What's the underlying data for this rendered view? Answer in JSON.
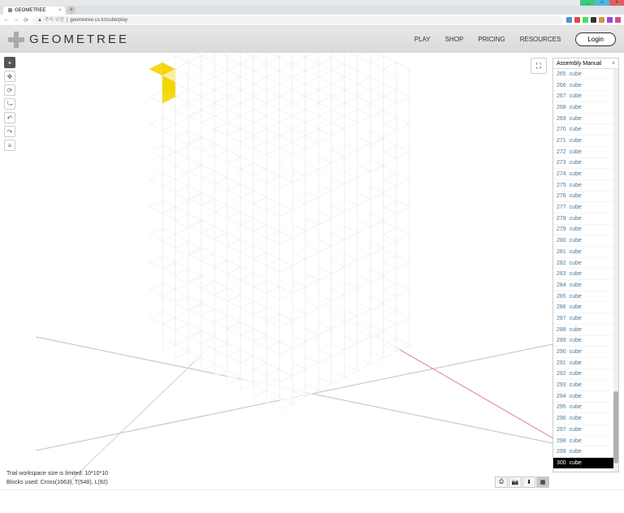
{
  "window": {
    "title": "GEOMETREE"
  },
  "browser": {
    "tab_title": "GEOMETREE",
    "url": "geometree.co.kr/cube/play"
  },
  "header": {
    "brand": "GEOMETREE",
    "nav": {
      "play": "PLAY",
      "shop": "SHOP",
      "pricing": "PRICING",
      "resources": "RESOURCES"
    },
    "login": "Login"
  },
  "toolbar": {
    "add": "+",
    "move": "✥",
    "rotate": "⟳",
    "orbit": "⤿",
    "undo": "↶",
    "redo": "↷",
    "list": "≡"
  },
  "panel": {
    "title": "Assembly Manual",
    "items": [
      {
        "n": "265",
        "t": "cube"
      },
      {
        "n": "266",
        "t": "cube"
      },
      {
        "n": "267",
        "t": "cube"
      },
      {
        "n": "268",
        "t": "cube"
      },
      {
        "n": "269",
        "t": "cube"
      },
      {
        "n": "270",
        "t": "cube"
      },
      {
        "n": "271",
        "t": "cube"
      },
      {
        "n": "272",
        "t": "cube"
      },
      {
        "n": "273",
        "t": "cube"
      },
      {
        "n": "274",
        "t": "cube"
      },
      {
        "n": "275",
        "t": "cube"
      },
      {
        "n": "276",
        "t": "cube"
      },
      {
        "n": "277",
        "t": "cube"
      },
      {
        "n": "278",
        "t": "cube"
      },
      {
        "n": "279",
        "t": "cube"
      },
      {
        "n": "280",
        "t": "cube"
      },
      {
        "n": "281",
        "t": "cube"
      },
      {
        "n": "282",
        "t": "cube"
      },
      {
        "n": "283",
        "t": "cube"
      },
      {
        "n": "284",
        "t": "cube"
      },
      {
        "n": "285",
        "t": "cube"
      },
      {
        "n": "286",
        "t": "cube"
      },
      {
        "n": "287",
        "t": "cube"
      },
      {
        "n": "288",
        "t": "cube"
      },
      {
        "n": "289",
        "t": "cube"
      },
      {
        "n": "290",
        "t": "cube"
      },
      {
        "n": "291",
        "t": "cube"
      },
      {
        "n": "292",
        "t": "cube"
      },
      {
        "n": "293",
        "t": "cube"
      },
      {
        "n": "294",
        "t": "cube"
      },
      {
        "n": "295",
        "t": "cube"
      },
      {
        "n": "296",
        "t": "cube"
      },
      {
        "n": "297",
        "t": "cube"
      },
      {
        "n": "298",
        "t": "cube"
      },
      {
        "n": "299",
        "t": "cube"
      },
      {
        "n": "300",
        "t": "cube"
      }
    ],
    "selected_index": 35,
    "scroll": {
      "thumb_top_pct": 80,
      "thumb_height_pct": 18
    }
  },
  "status": {
    "line1": "Trial workspace size is limited: 10*10*10",
    "line2": "Blocks used: Cross(1663), T(548), L(92)"
  },
  "scene": {
    "axes": {
      "y_color": "#4dd24d",
      "x_color": "#e08080",
      "z_color": "#9090e0",
      "grey": "#c0c0c0"
    },
    "highlight_color": "#f5d500",
    "grid_size": 10
  },
  "ext_colors": [
    "#4a90d9",
    "#d94a4a",
    "#4ad96a",
    "#333",
    "#d9904a",
    "#904ad9",
    "#d94a90"
  ]
}
